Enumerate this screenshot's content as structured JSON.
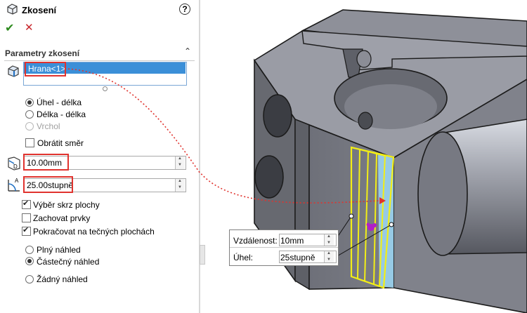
{
  "panel": {
    "title": "Zkosení",
    "help_symbol": "?",
    "ok_symbol": "✔",
    "cancel_symbol": "✕",
    "section_title": "Parametry zkosení",
    "edge_item": "Hrana<1>",
    "radios": [
      {
        "label": "Úhel - délka",
        "checked": true,
        "disabled": false
      },
      {
        "label": "Délka - délka",
        "checked": false,
        "disabled": false
      },
      {
        "label": "Vrchol",
        "checked": false,
        "disabled": true
      }
    ],
    "flip_label": "Obrátit směr",
    "distance_value": "10.00mm",
    "angle_value": "25.00stupně",
    "distance_icon_letter": "D",
    "angle_icon_letter": "A",
    "checkboxes": [
      {
        "label": "Výběr skrz plochy",
        "checked": true
      },
      {
        "label": "Zachovat prvky",
        "checked": false
      },
      {
        "label": "Pokračovat na tečných plochách",
        "checked": true
      }
    ],
    "preview": [
      {
        "label": "Plný náhled",
        "checked": false
      },
      {
        "label": "Částečný náhled",
        "checked": true
      },
      {
        "label": "Žádný náhled",
        "checked": false
      }
    ]
  },
  "callout": {
    "distance_label": "Vzdálenost:",
    "distance_value": "10mm",
    "angle_label": "Úhel:",
    "angle_value": "25stupně"
  },
  "colors": {
    "accent": "#3b8fd8",
    "highlight": "#e0332e",
    "preview_edge": "#ffff00",
    "model_gray": "#7c7e86"
  }
}
